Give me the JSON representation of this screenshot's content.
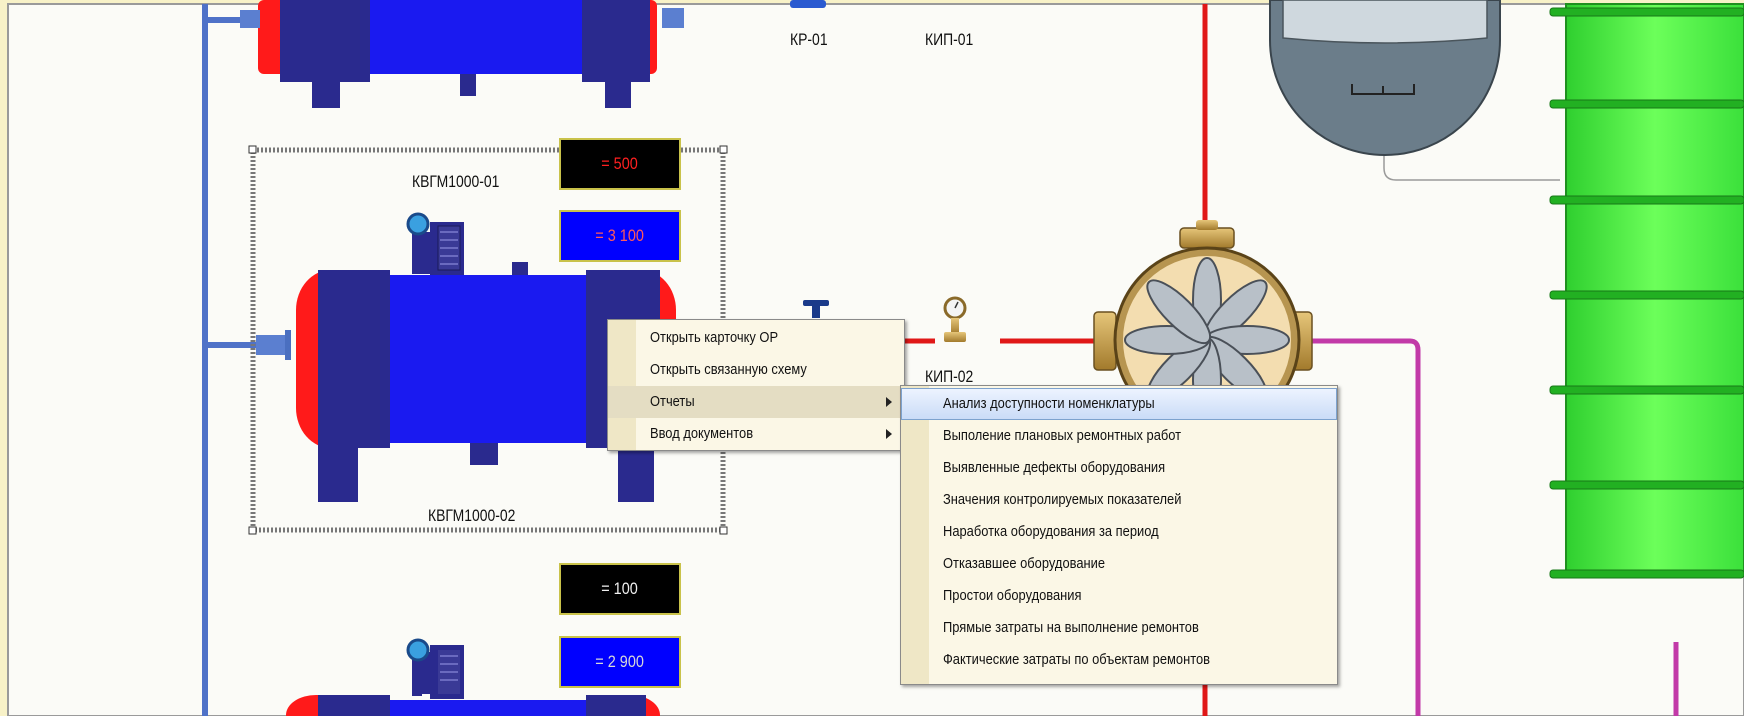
{
  "labels": {
    "kr01": "КР-01",
    "kip01": "КИП-01",
    "kip02": "КИП-02",
    "boiler1": "КВГМ1000-01",
    "boiler2": "КВГМ1000-02"
  },
  "displays": {
    "d1": "= 500",
    "d2": "= 3 100",
    "d3": "= 100",
    "d4": "= 2 900"
  },
  "context_menu": {
    "items": [
      {
        "label": "Открыть карточку ОР"
      },
      {
        "label": "Открыть связанную схему"
      },
      {
        "label": "Отчеты"
      },
      {
        "label": "Ввод документов"
      }
    ]
  },
  "reports_submenu": {
    "items": [
      {
        "label": "Анализ доступности номенклатуры"
      },
      {
        "label": "Выполение плановых ремонтных работ"
      },
      {
        "label": "Выявленные дефекты оборудования"
      },
      {
        "label": "Значения контролируемых показателей"
      },
      {
        "label": "Наработка оборудования за период"
      },
      {
        "label": "Отказавшее оборудование"
      },
      {
        "label": "Простои оборудования"
      },
      {
        "label": "Прямые затраты на выполнение ремонтов"
      },
      {
        "label": "Фактические затраты по объектам ремонтов"
      }
    ]
  },
  "colors": {
    "background": "#f8f2c8",
    "boiler_body": "#1a1aee",
    "boiler_dark": "#2a2a8c",
    "boiler_cap": "#ff1a1a",
    "pipe_blue": "#5577cc",
    "pipe_red": "#e02020",
    "pipe_magenta": "#c03aa8",
    "tank_green": "#33dd33"
  }
}
